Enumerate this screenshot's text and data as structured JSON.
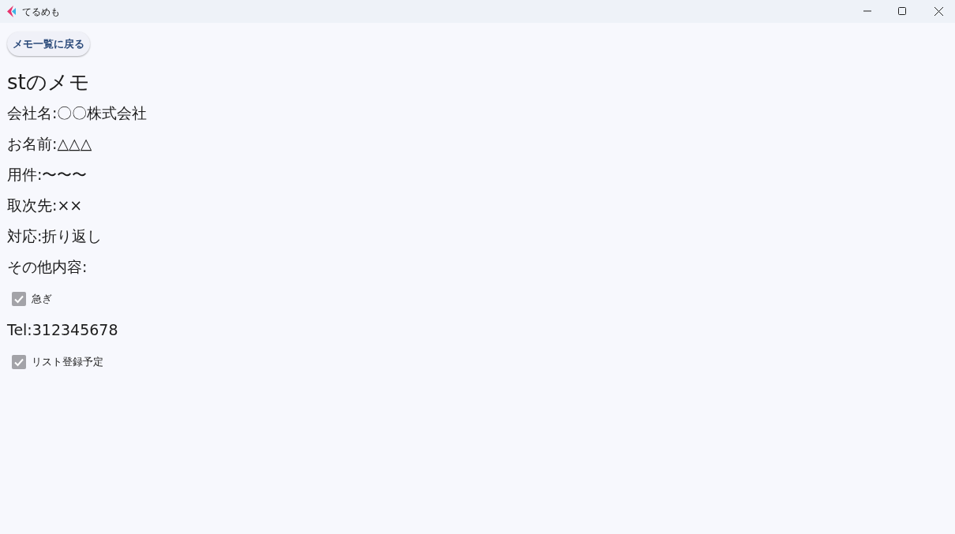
{
  "window": {
    "title": "てるめも"
  },
  "back_button": "メモ一覧に戻る",
  "heading": "stのメモ",
  "items": [
    {
      "kind": "text",
      "text": "会社名:〇〇株式会社"
    },
    {
      "kind": "text",
      "text": "お名前:△△△"
    },
    {
      "kind": "text",
      "text": "用件:〜〜〜"
    },
    {
      "kind": "text",
      "text": "取次先:××"
    },
    {
      "kind": "text",
      "text": "対応:折り返し"
    },
    {
      "kind": "text",
      "text": "その他内容:"
    },
    {
      "kind": "checkbox",
      "label": "急ぎ",
      "checked": true
    },
    {
      "kind": "text",
      "text": "Tel:312345678"
    },
    {
      "kind": "checkbox",
      "label": "リスト登録予定",
      "checked": true
    }
  ]
}
